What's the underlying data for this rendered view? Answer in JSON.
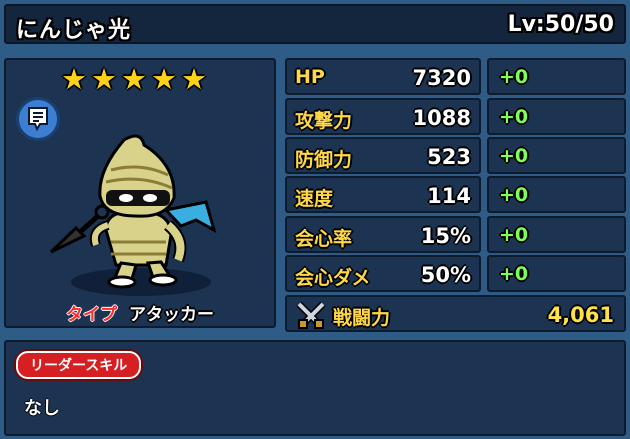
{
  "header": {
    "name": "にんじゃ光",
    "level": "Lv:50/50"
  },
  "character": {
    "stars": 5,
    "star_glyphs": [
      "★",
      "★",
      "★",
      "★",
      "★"
    ],
    "type_label": "タイプ",
    "type_value": "アタッカー",
    "memo_icon": "memo-icon"
  },
  "stats": [
    {
      "name": "HP",
      "value": "7320",
      "bonus": "+0"
    },
    {
      "name": "攻撃力",
      "value": "1088",
      "bonus": "+0"
    },
    {
      "name": "防御力",
      "value": "523",
      "bonus": "+0"
    },
    {
      "name": "速度",
      "value": "114",
      "bonus": "+0"
    },
    {
      "name": "会心率",
      "value": "15%",
      "bonus": "+0"
    },
    {
      "name": "会心ダメ",
      "value": "50%",
      "bonus": "+0"
    }
  ],
  "power": {
    "label": "戦闘力",
    "value": "4,061",
    "icon": "crossed-swords-icon"
  },
  "skill": {
    "badge": "リーダースキル",
    "text": "なし"
  },
  "colors": {
    "stat_label": "#ffd84a",
    "bonus": "#7dff5a",
    "star": "#ffd21a",
    "panel": "#1c3352",
    "background": "#2f5b87"
  }
}
